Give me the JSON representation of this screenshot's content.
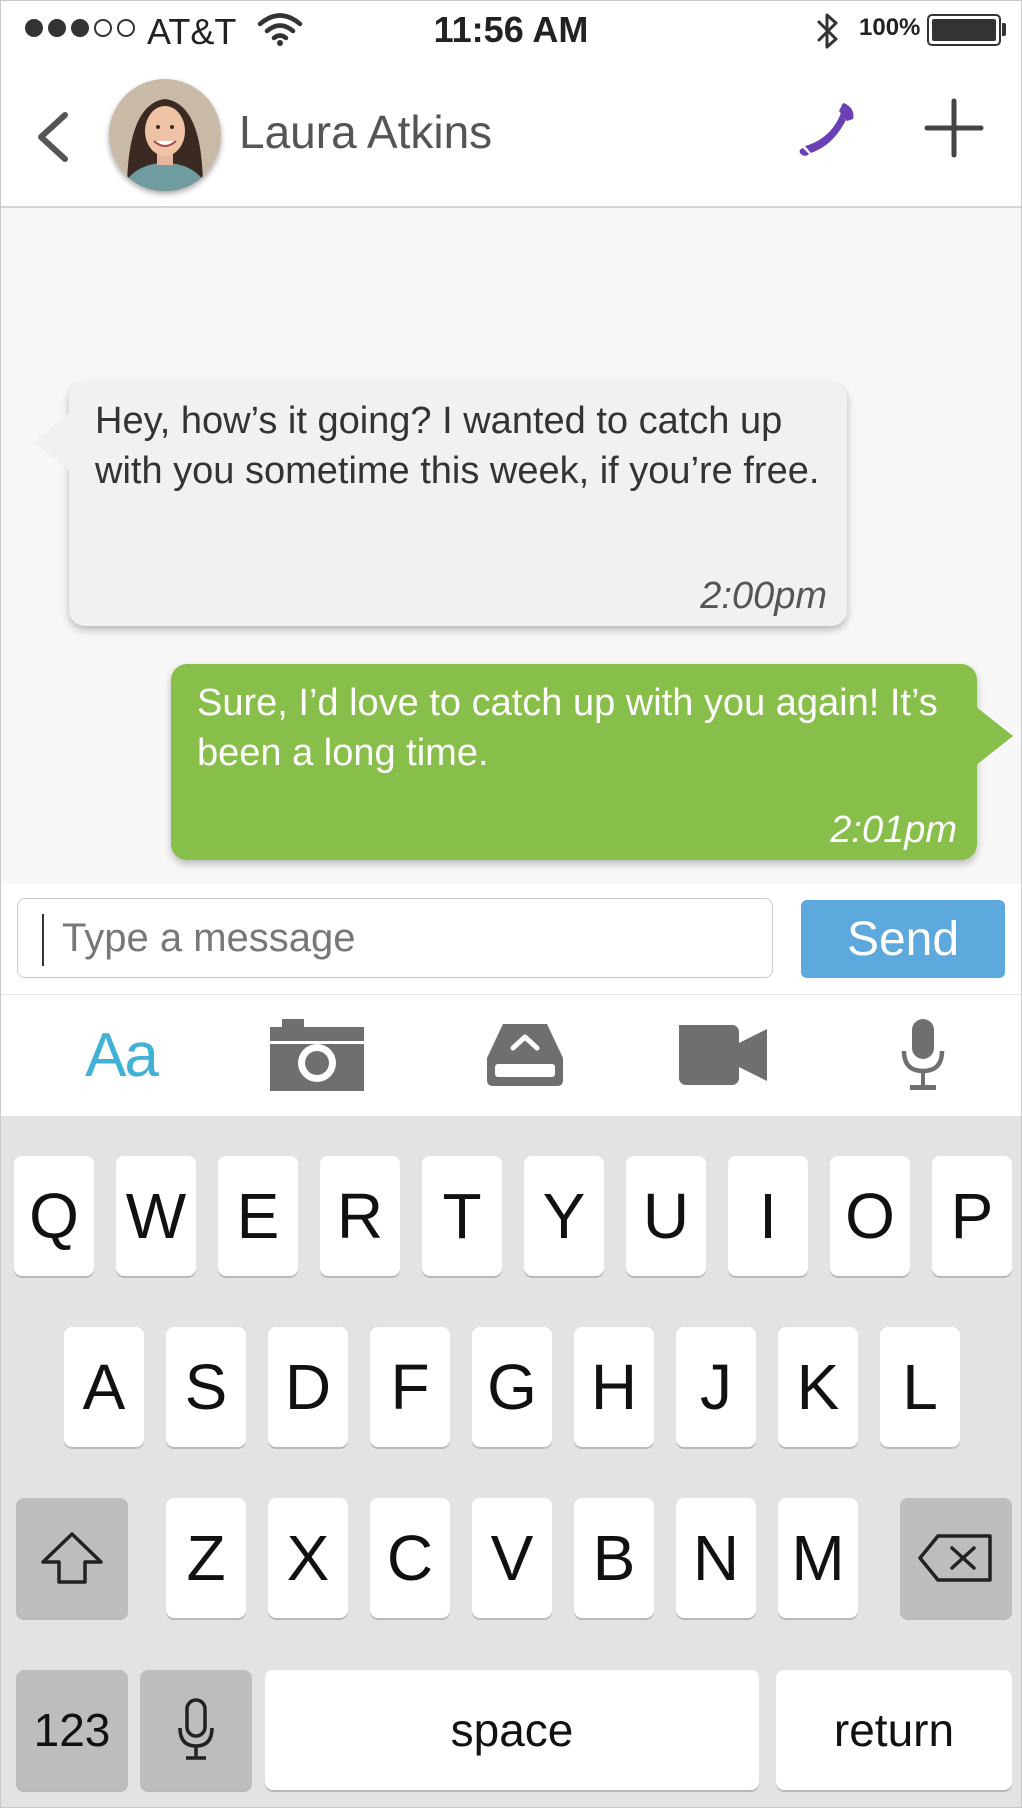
{
  "status_bar": {
    "carrier": "AT&T",
    "time": "11:56 AM",
    "battery": "100%"
  },
  "header": {
    "contact_name": "Laura Atkins"
  },
  "messages": [
    {
      "direction": "incoming",
      "text": "Hey, how’s it going? I wanted to catch up with you sometime this week, if you’re free.",
      "time": "2:00pm"
    },
    {
      "direction": "outgoing",
      "text": "Sure, I’d love to catch up with you again! It’s been a long time.",
      "time": "2:01pm"
    }
  ],
  "composer": {
    "placeholder": "Type a message",
    "value": "",
    "send_label": "Send"
  },
  "toolbar": {
    "text_format_label": "Aa",
    "icons": [
      "camera-icon",
      "upload-icon",
      "video-icon",
      "microphone-icon"
    ]
  },
  "keyboard": {
    "row1": [
      "Q",
      "W",
      "E",
      "R",
      "T",
      "Y",
      "U",
      "I",
      "O",
      "P"
    ],
    "row2": [
      "A",
      "S",
      "D",
      "F",
      "G",
      "H",
      "J",
      "K",
      "L"
    ],
    "row3": [
      "Z",
      "X",
      "C",
      "V",
      "B",
      "N",
      "M"
    ],
    "numbers_label": "123",
    "space_label": "space",
    "return_label": "return"
  },
  "colors": {
    "accent_call": "#6b3fb5",
    "outgoing_bubble": "#88bf4a",
    "send_button": "#5da9de",
    "text_format": "#3fb2d6"
  }
}
